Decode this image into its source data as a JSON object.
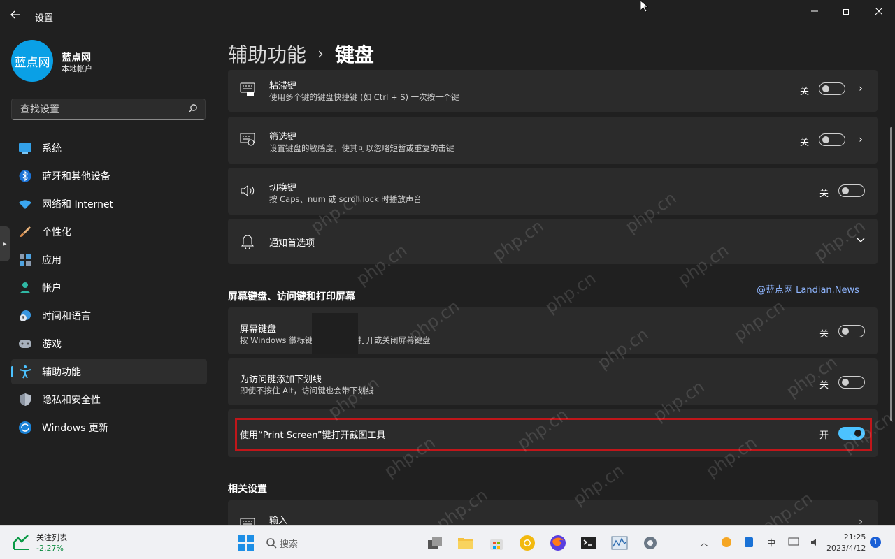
{
  "app": {
    "title": "设置"
  },
  "user": {
    "avatar_text": "蓝点网",
    "name": "蓝点网",
    "type": "本地帐户"
  },
  "search": {
    "placeholder": "查找设置"
  },
  "nav": {
    "items": [
      {
        "label": "系统",
        "icon": "monitor-icon"
      },
      {
        "label": "蓝牙和其他设备",
        "icon": "bluetooth-icon"
      },
      {
        "label": "网络和 Internet",
        "icon": "wifi-icon"
      },
      {
        "label": "个性化",
        "icon": "brush-icon"
      },
      {
        "label": "应用",
        "icon": "apps-icon"
      },
      {
        "label": "帐户",
        "icon": "person-icon"
      },
      {
        "label": "时间和语言",
        "icon": "clock-globe-icon"
      },
      {
        "label": "游戏",
        "icon": "gamepad-icon"
      },
      {
        "label": "辅助功能",
        "icon": "accessibility-icon",
        "active": true
      },
      {
        "label": "隐私和安全性",
        "icon": "shield-icon"
      },
      {
        "label": "Windows 更新",
        "icon": "update-icon"
      }
    ]
  },
  "breadcrumb": {
    "parent": "辅助功能",
    "separator": "›",
    "current": "键盘"
  },
  "settings": {
    "sticky": {
      "title": "粘滞键",
      "desc": "使用多个键的键盘快捷键 (如 Ctrl + S) 一次按一个键",
      "state": "关"
    },
    "filter": {
      "title": "筛选键",
      "desc": "设置键盘的敏感度，使其可以忽略短暂或重复的击键",
      "state": "关"
    },
    "toggle_keys": {
      "title": "切换键",
      "desc": "按 Caps、num 或 scroll lock 时播放声音",
      "state": "关"
    },
    "notify": {
      "title": "通知首选项"
    },
    "section_onscreen": "屏幕键盘、访问键和打印屏幕",
    "onscreen": {
      "title": "屏幕键盘",
      "desc_a": "按 Windows 徽标键",
      "desc_b": "打开或关闭屏幕键盘",
      "state": "关"
    },
    "underline": {
      "title": "为访问键添加下划线",
      "desc": "即使不按住 Alt，访问键也会带下划线",
      "state": "关"
    },
    "printscreen": {
      "title": "使用“Print Screen”键打开截图工具",
      "state": "开"
    },
    "section_related": "相关设置",
    "input": {
      "title": "输入"
    }
  },
  "credit": "@蓝点网 Landian.News",
  "watermark_text": "php.cn",
  "taskbar": {
    "stock_name": "关注列表",
    "stock_value": "-2.27%",
    "search_label": "搜索",
    "tray_lang": "中",
    "time": "21:25",
    "date": "2023/4/12",
    "notification_count": "1"
  },
  "colors": {
    "accent": "#4cc2ff",
    "highlight_border": "#c0161a",
    "background": "#202020",
    "card": "#2b2b2b"
  }
}
